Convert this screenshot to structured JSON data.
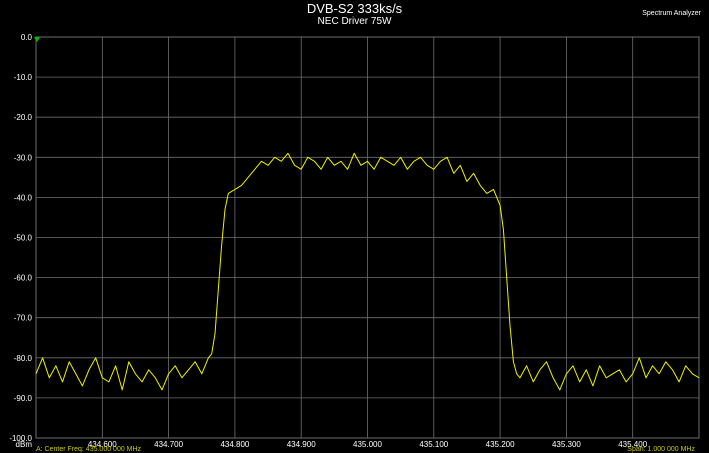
{
  "window": {
    "title": "DVB-S2 333ks/s",
    "subtitle": "NEC Driver 75W",
    "app_label": "Spectrum Analyzer"
  },
  "footer": {
    "left": "A: Center Freq: 435.000 000 MHz",
    "right": "Span: 1.000 000 MHz"
  },
  "colors": {
    "background": "#000000",
    "grid": "#6e6e6e",
    "trace": "#f0f000",
    "text": "#ffffff",
    "marker": "#00c000"
  },
  "chart_data": {
    "type": "line",
    "title": "DVB-S2 333ks/s",
    "subtitle": "NEC Driver 75W",
    "ylabel": "dBm",
    "xlabel": "",
    "grid": true,
    "xlim": [
      434.5,
      435.5
    ],
    "ylim": [
      -100,
      0
    ],
    "x_ticks": [
      "434.600",
      "434.700",
      "434.800",
      "434.900",
      "435.000",
      "435.100",
      "435.200",
      "435.300",
      "435.400"
    ],
    "x_tick_values": [
      434.6,
      434.7,
      434.8,
      434.9,
      435.0,
      435.1,
      435.2,
      435.3,
      435.4
    ],
    "y_ticks": [
      "0.0",
      "-10.0",
      "-20.0",
      "-30.0",
      "-40.0",
      "-50.0",
      "-60.0",
      "-70.0",
      "-80.0",
      "-90.0",
      "-100.0"
    ],
    "y_tick_values": [
      0,
      -10,
      -20,
      -30,
      -40,
      -50,
      -60,
      -70,
      -80,
      -90,
      -100
    ],
    "marker": {
      "x": 434.5,
      "y": 0.0
    },
    "series": [
      {
        "x": [
          434.5,
          434.51,
          434.52,
          434.53,
          434.54,
          434.55,
          434.56,
          434.57,
          434.58,
          434.59,
          434.6,
          434.61,
          434.62,
          434.63,
          434.64,
          434.65,
          434.66,
          434.67,
          434.68,
          434.69,
          434.7,
          434.71,
          434.72,
          434.73,
          434.74,
          434.75,
          434.76,
          434.765,
          434.77,
          434.775,
          434.78,
          434.785,
          434.79,
          434.8,
          434.81,
          434.82,
          434.83,
          434.84,
          434.85,
          434.86,
          434.87,
          434.88,
          434.89,
          434.9,
          434.91,
          434.92,
          434.93,
          434.94,
          434.95,
          434.96,
          434.97,
          434.98,
          434.99,
          435.0,
          435.01,
          435.02,
          435.03,
          435.04,
          435.05,
          435.06,
          435.07,
          435.08,
          435.09,
          435.1,
          435.11,
          435.12,
          435.13,
          435.14,
          435.15,
          435.16,
          435.17,
          435.18,
          435.19,
          435.2,
          435.205,
          435.21,
          435.215,
          435.22,
          435.225,
          435.23,
          435.24,
          435.25,
          435.26,
          435.27,
          435.28,
          435.29,
          435.3,
          435.31,
          435.32,
          435.33,
          435.34,
          435.35,
          435.36,
          435.37,
          435.38,
          435.39,
          435.4,
          435.41,
          435.42,
          435.43,
          435.44,
          435.45,
          435.46,
          435.47,
          435.48,
          435.49,
          435.5
        ],
        "y": [
          -84,
          -80,
          -85,
          -82,
          -86,
          -81,
          -84,
          -87,
          -83,
          -80,
          -85,
          -86,
          -82,
          -88,
          -81,
          -84,
          -86,
          -83,
          -85,
          -88,
          -84,
          -82,
          -85,
          -83,
          -81,
          -84,
          -80,
          -79,
          -74,
          -63,
          -52,
          -43,
          -39,
          -38,
          -37,
          -35,
          -33,
          -31,
          -32,
          -30,
          -31,
          -29,
          -32,
          -33,
          -30,
          -31,
          -33,
          -30,
          -32,
          -31,
          -33,
          -29,
          -32,
          -31,
          -33,
          -30,
          -31,
          -32,
          -30,
          -33,
          -31,
          -30,
          -32,
          -33,
          -31,
          -30,
          -34,
          -32,
          -36,
          -34,
          -37,
          -39,
          -38,
          -42,
          -48,
          -60,
          -72,
          -81,
          -84,
          -85,
          -82,
          -86,
          -83,
          -81,
          -85,
          -88,
          -84,
          -82,
          -86,
          -83,
          -87,
          -82,
          -85,
          -84,
          -83,
          -86,
          -84,
          -80,
          -85,
          -82,
          -84,
          -81,
          -83,
          -86,
          -82,
          -84,
          -85
        ]
      }
    ]
  }
}
